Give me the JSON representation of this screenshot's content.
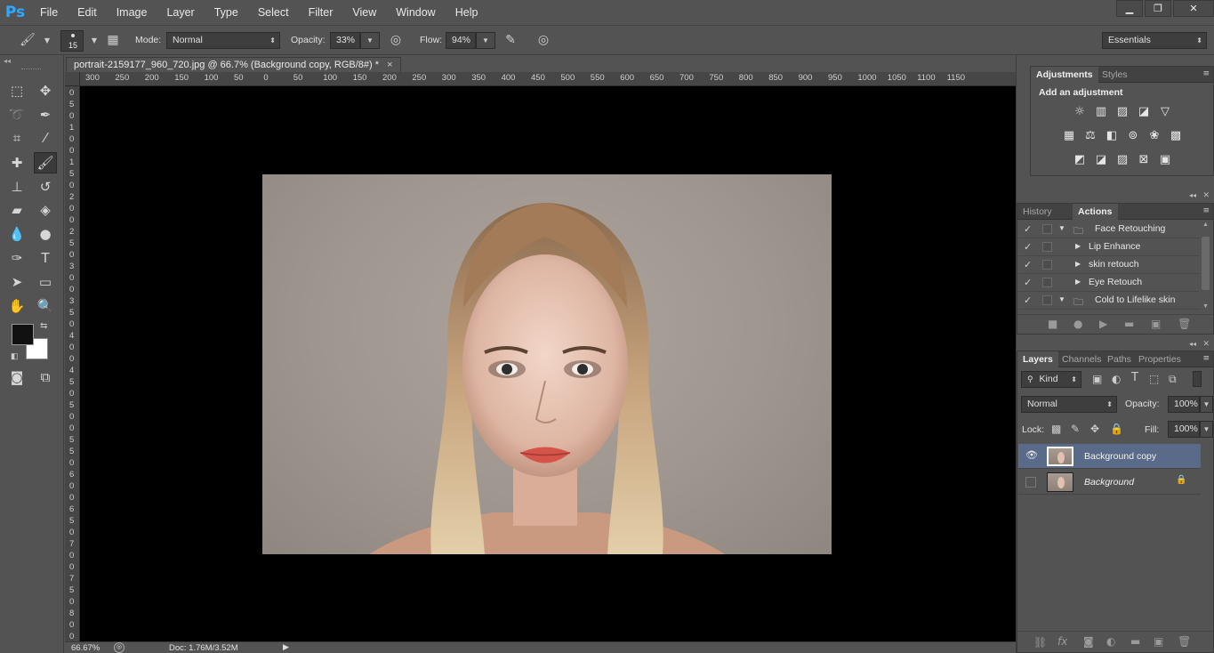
{
  "app": {
    "logo": "Ps"
  },
  "menu": [
    "File",
    "Edit",
    "Image",
    "Layer",
    "Type",
    "Select",
    "Filter",
    "View",
    "Window",
    "Help"
  ],
  "window_controls": {
    "minimize": "▁",
    "restore": "❐",
    "close": "✕"
  },
  "options": {
    "brush_size": "15",
    "mode_label": "Mode:",
    "mode_value": "Normal",
    "opacity_label": "Opacity:",
    "opacity_value": "33%",
    "flow_label": "Flow:",
    "flow_value": "94%",
    "workspace": "Essentials"
  },
  "document": {
    "tab_title": "portrait-2159177_960_720.jpg @ 66.7% (Background copy, RGB/8#) *",
    "close": "×",
    "zoom": "66.67%",
    "doc_size": "Doc: 1.76M/3.52M"
  },
  "ruler_top": [
    "300",
    "250",
    "200",
    "150",
    "100",
    "50",
    "0",
    "50",
    "100",
    "150",
    "200",
    "250",
    "300",
    "350",
    "400",
    "450",
    "500",
    "550",
    "600",
    "650",
    "700",
    "750",
    "800",
    "850",
    "900",
    "950",
    "1000",
    "1050",
    "1100",
    "1150"
  ],
  "ruler_left": [
    "0",
    "5",
    "0",
    "1",
    "0",
    "0",
    "1",
    "5",
    "0",
    "2",
    "0",
    "0",
    "2",
    "5",
    "0",
    "3",
    "0",
    "0",
    "3",
    "5",
    "0",
    "4",
    "0",
    "0",
    "4",
    "5",
    "0",
    "5",
    "0",
    "0",
    "5",
    "5",
    "0",
    "6",
    "0",
    "0",
    "6",
    "5",
    "0",
    "7",
    "0",
    "0",
    "7",
    "5",
    "0",
    "8",
    "0",
    "0"
  ],
  "adjustments": {
    "tabs": [
      "Adjustments",
      "Styles"
    ],
    "heading": "Add an adjustment",
    "icons": [
      [
        "brightness-icon",
        "levels-icon",
        "curves-icon",
        "exposure-icon",
        "vibrance-icon"
      ],
      [
        "hue-saturation-icon",
        "color-balance-icon",
        "black-white-icon",
        "photo-filter-icon",
        "channel-mixer-icon",
        "color-lookup-icon"
      ],
      [
        "invert-icon",
        "posterize-icon",
        "threshold-icon",
        "selective-color-icon",
        "gradient-map-icon"
      ]
    ]
  },
  "actions": {
    "tabs": [
      "History",
      "Actions"
    ],
    "rows": [
      {
        "label": "Face Retouching",
        "type": "set",
        "open": true
      },
      {
        "label": "Lip Enhance",
        "type": "action"
      },
      {
        "label": "skin retouch",
        "type": "action"
      },
      {
        "label": "Eye Retouch",
        "type": "action"
      },
      {
        "label": "Cold to Lifelike skin",
        "type": "set",
        "open": true
      }
    ]
  },
  "layers": {
    "tabs": [
      "Layers",
      "Channels",
      "Paths",
      "Properties"
    ],
    "filter_kind": "Kind",
    "blend_mode": "Normal",
    "opacity_label": "Opacity:",
    "opacity_value": "100%",
    "lock_label": "Lock:",
    "fill_label": "Fill:",
    "fill_value": "100%",
    "items": [
      {
        "name": "Background copy",
        "visible": true,
        "selected": true
      },
      {
        "name": "Background",
        "visible": false,
        "locked": true
      }
    ]
  }
}
